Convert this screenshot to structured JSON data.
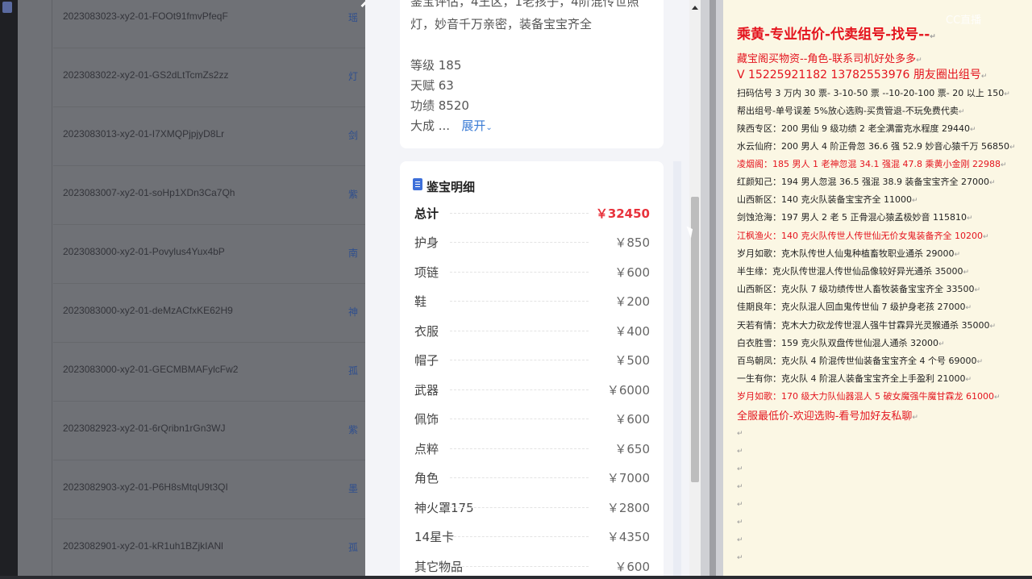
{
  "orders": [
    {
      "id": "2023083023-xy2-01-FOOt91fmvPfeqF",
      "link": "瑶"
    },
    {
      "id": "2023083022-xy2-01-GS2dLtTcmZs2zz",
      "link": "灯"
    },
    {
      "id": "2023083013-xy2-01-I7XMQPjpjyD8Lr",
      "link": "剑"
    },
    {
      "id": "2023083007-xy2-01-soHp1XDn3Ca7Qh",
      "link": "紫"
    },
    {
      "id": "2023083000-xy2-01-Povylus4Yux4bP",
      "link": "南"
    },
    {
      "id": "2023083000-xy2-01-deMzACfxKE62H9",
      "link": "神"
    },
    {
      "id": "2023083000-xy2-01-GECMBMAFylcFw2",
      "link": "孤"
    },
    {
      "id": "2023082923-xy2-01-6rQribn1rGn3WJ",
      "link": "紫"
    },
    {
      "id": "2023082903-xy2-01-P6H8sMtqU9t3QI",
      "link": "墨"
    },
    {
      "id": "2023082901-xy2-01-kR1uh1BZjkIANl",
      "link": "孤"
    }
  ],
  "modal": {
    "close": "✕",
    "desc_line1": "鉴宝评估，4王区，1老孩子，4阶混传世照",
    "desc_line2": "灯，妙音千万亲密，装备宝宝齐全",
    "attrs": [
      "等级 185",
      "天赋 63",
      "功绩 8520"
    ],
    "more_prefix": "大成 ...",
    "expand": "展开",
    "section_title": "鉴宝明细",
    "total_label": "总计",
    "total_value": "￥32450",
    "items": [
      {
        "name": "护身",
        "price": "￥850"
      },
      {
        "name": "项链",
        "price": "￥600"
      },
      {
        "name": "鞋",
        "price": "￥200"
      },
      {
        "name": "衣服",
        "price": "￥400"
      },
      {
        "name": "帽子",
        "price": "￥500"
      },
      {
        "name": "武器",
        "price": "￥6000"
      },
      {
        "name": "佩饰",
        "price": "￥600"
      },
      {
        "name": "点粹",
        "price": "￥650"
      },
      {
        "name": "角色",
        "price": "￥7000"
      },
      {
        "name": "神火罩175",
        "price": "￥2800"
      },
      {
        "name": "14星卡",
        "price": "￥4350"
      },
      {
        "name": "其它物品",
        "price": "￥600"
      }
    ]
  },
  "watermark": "CC直播",
  "notepad": {
    "lines": [
      {
        "text": "乘黄-专业估价-代卖组号-找号--",
        "style": "big red"
      },
      {
        "text": "藏宝阁买物资--角色-联系司机好处多多",
        "style": "mid red"
      },
      {
        "text": "V 15225921182       13782553976 朋友圈出组号",
        "style": "mid2 red"
      },
      {
        "text": "扫码估号 3 万内 30 票- 3-10-50 票  --10-20-100 票- 20 以上 150",
        "style": ""
      },
      {
        "text": "帮出组号-单号误差 5%放心选购-买贵管退-不玩免费代卖",
        "style": ""
      },
      {
        "text": "陕西专区：200 男仙 9 级功绩 2 老全满雷克水程度 29440",
        "style": ""
      },
      {
        "text": "水云仙府：200 男人 4 阶正骨忽 36.6 强 52.9 妙音心猿千万 56850",
        "style": ""
      },
      {
        "text": "凌烟阁：185 男人 1 老神忽混 34.1 强混 47.8 乘黄小金刚 22988",
        "style": "red"
      },
      {
        "text": "红颜知己：194 男人忽混 36.5 强混 38.9 装备宝宝齐全 27000",
        "style": ""
      },
      {
        "text": "山西新区：140 克火队装备宝宝齐全 11000",
        "style": ""
      },
      {
        "text": "剑蚀沧海：197 男人 2 老 5 正骨混心猿孟极妙音 115810",
        "style": ""
      },
      {
        "text": "江枫渔火：140 克火队传世人传世仙无价女鬼装备齐全 10200",
        "style": "red"
      },
      {
        "text": "岁月如歌：克木队传世人仙鬼种植畜牧职业通杀 29000",
        "style": ""
      },
      {
        "text": "半生缘：克火队传世混人传世仙品像较好异光通杀 35000",
        "style": ""
      },
      {
        "text": "山西新区：克火队 7 级功绩传世人畜牧装备宝宝齐全 33500",
        "style": ""
      },
      {
        "text": "佳期良年：克火队混人回血鬼传世仙 7 级护身老孩 27000",
        "style": ""
      },
      {
        "text": "天若有情：克木大力砍龙传世混人强牛甘霖异光灵猴通杀 35000",
        "style": ""
      },
      {
        "text": "白衣胜雪：159 克火队双盘传世仙混人通杀 32000",
        "style": ""
      },
      {
        "text": "百鸟朝凤：克火队 4 阶混传世仙装备宝宝齐全 4 个号 69000",
        "style": ""
      },
      {
        "text": "一生有你：克火队 4 阶混人装备宝宝齐全上手盈利 21000",
        "style": ""
      },
      {
        "text": "岁月如歌：170 级大力队仙器混人 5 破女魔强牛魔甘霖龙 61000",
        "style": "red"
      },
      {
        "text": "全服最低价-欢迎选购-看号加好友私聊",
        "style": "mid red"
      }
    ]
  }
}
